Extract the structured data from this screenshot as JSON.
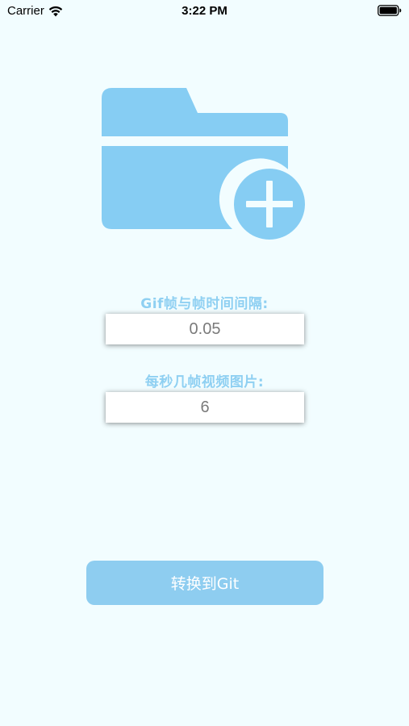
{
  "status_bar": {
    "carrier": "Carrier",
    "time": "3:22 PM"
  },
  "icons": {
    "main": "folder-add-icon"
  },
  "form": {
    "interval_label": "Gif帧与帧时间间隔:",
    "interval_value": "0.05",
    "fps_label": "每秒几帧视频图片:",
    "fps_value": "6"
  },
  "actions": {
    "convert_label": "转换到Git"
  },
  "colors": {
    "background": "#f2fdff",
    "accent": "#8ecdf0",
    "label": "#8fd0f2"
  }
}
